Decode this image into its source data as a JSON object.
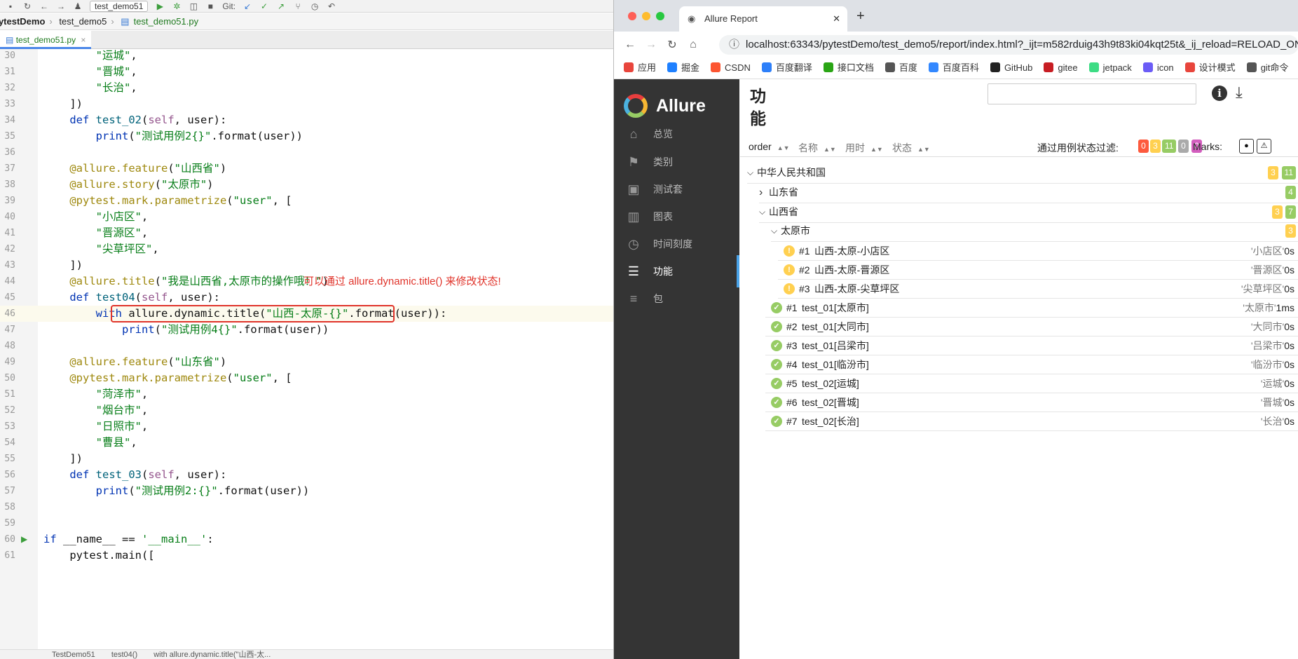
{
  "ide": {
    "run_config": "test_demo51",
    "git_label": "Git:",
    "breadcrumbs": [
      "pytestDemo",
      "test_demo5",
      "test_demo51.py"
    ],
    "file_tab": "test_demo51.py",
    "annotation": "可以通过 allure.dynamic.title() 来修改状态!",
    "status_crumbs": [
      "TestDemo51",
      "test04()",
      "with allure.dynamic.title(\"山西-太..."
    ],
    "lines": [
      {
        "n": "30",
        "code": "        \"运城\","
      },
      {
        "n": "31",
        "code": "        \"晋城\","
      },
      {
        "n": "32",
        "code": "        \"长治\","
      },
      {
        "n": "33",
        "code": "    ])"
      },
      {
        "n": "34",
        "code": "    def test_02(self, user):"
      },
      {
        "n": "35",
        "code": "        print(\"测试用例2{}\".format(user))"
      },
      {
        "n": "36",
        "code": ""
      },
      {
        "n": "37",
        "code": "    @allure.feature(\"山西省\")"
      },
      {
        "n": "38",
        "code": "    @allure.story(\"太原市\")"
      },
      {
        "n": "39",
        "code": "    @pytest.mark.parametrize(\"user\", ["
      },
      {
        "n": "40",
        "code": "        \"小店区\","
      },
      {
        "n": "41",
        "code": "        \"晋源区\","
      },
      {
        "n": "42",
        "code": "        \"尖草坪区\","
      },
      {
        "n": "43",
        "code": "    ])"
      },
      {
        "n": "44",
        "code": "    @allure.title(\"我是山西省,太原市的操作哦！\")"
      },
      {
        "n": "45",
        "code": "    def test04(self, user):"
      },
      {
        "n": "46",
        "code": "        with allure.dynamic.title(\"山西-太原-{}\".format(user)):"
      },
      {
        "n": "47",
        "code": "            print(\"测试用例4{}\".format(user))"
      },
      {
        "n": "48",
        "code": ""
      },
      {
        "n": "49",
        "code": "    @allure.feature(\"山东省\")"
      },
      {
        "n": "50",
        "code": "    @pytest.mark.parametrize(\"user\", ["
      },
      {
        "n": "51",
        "code": "        \"菏泽市\","
      },
      {
        "n": "52",
        "code": "        \"烟台市\","
      },
      {
        "n": "53",
        "code": "        \"日照市\","
      },
      {
        "n": "54",
        "code": "        \"曹县\","
      },
      {
        "n": "55",
        "code": "    ])"
      },
      {
        "n": "56",
        "code": "    def test_03(self, user):"
      },
      {
        "n": "57",
        "code": "        print(\"测试用例2:{}\".format(user))"
      },
      {
        "n": "58",
        "code": ""
      },
      {
        "n": "59",
        "code": ""
      },
      {
        "n": "60",
        "code": "if __name__ == '__main__':"
      },
      {
        "n": "61",
        "code": "    pytest.main(["
      }
    ]
  },
  "browser": {
    "tab_title": "Allure Report",
    "url": "localhost:63343/pytestDemo/test_demo5/report/index.html?_ijt=m582rduig43h9t83ki04kqt25t&_ij_reload=RELOAD_ON_SAVE",
    "bookmarks": [
      {
        "label": "应用",
        "color": "#e8453c"
      },
      {
        "label": "掘金",
        "color": "#1e80ff"
      },
      {
        "label": "CSDN",
        "color": "#fc5531"
      },
      {
        "label": "百度翻译",
        "color": "#2d7ff9"
      },
      {
        "label": "接口文档",
        "color": "#2aa515"
      },
      {
        "label": "百度",
        "color": "#555555"
      },
      {
        "label": "百度百科",
        "color": "#3388ff"
      },
      {
        "label": "GitHub",
        "color": "#222222"
      },
      {
        "label": "gitee",
        "color": "#c71d23"
      },
      {
        "label": "jetpack",
        "color": "#3ddc84"
      },
      {
        "label": "icon",
        "color": "#6b5cf6"
      },
      {
        "label": "设计模式",
        "color": "#e8453c"
      },
      {
        "label": "git命令",
        "color": "#555555"
      }
    ]
  },
  "allure": {
    "brand": "Allure",
    "nav": [
      {
        "label": "总览",
        "icon": "home-icon",
        "glyph": "⌂"
      },
      {
        "label": "类别",
        "icon": "flag-icon",
        "glyph": "⚑"
      },
      {
        "label": "测试套",
        "icon": "briefcase-icon",
        "glyph": "▣"
      },
      {
        "label": "图表",
        "icon": "bar-chart-icon",
        "glyph": "▥"
      },
      {
        "label": "时间刻度",
        "icon": "clock-icon",
        "glyph": "◷"
      },
      {
        "label": "功能",
        "icon": "list-icon",
        "glyph": "☰"
      },
      {
        "label": "包",
        "icon": "package-icon",
        "glyph": "≡"
      }
    ],
    "active_nav": 5,
    "page_title": "功能",
    "sort_columns": [
      "order",
      "名称",
      "用时",
      "状态"
    ],
    "filter_label": "通过用例状态过滤:",
    "filter_counts": [
      {
        "value": "0",
        "color": "#fd5a3e"
      },
      {
        "value": "3",
        "color": "#ffd050"
      },
      {
        "value": "11",
        "color": "#97cc64"
      },
      {
        "value": "0",
        "color": "#aaaaaa"
      },
      {
        "value": "0",
        "color": "#d35ebe"
      }
    ],
    "marks_label": "Marks:",
    "tree": {
      "root": {
        "label": "中华人民共和国",
        "counts": [
          {
            "value": "3",
            "color": "#ffd050"
          },
          {
            "value": "11",
            "color": "#97cc64"
          }
        ]
      },
      "shandong": {
        "label": "山东省",
        "counts": [
          {
            "value": "4",
            "color": "#97cc64"
          }
        ]
      },
      "shanxi": {
        "label": "山西省",
        "counts": [
          {
            "value": "3",
            "color": "#ffd050"
          },
          {
            "value": "7",
            "color": "#97cc64"
          }
        ]
      },
      "taiyuan": {
        "label": "太原市",
        "counts": [
          {
            "value": "3",
            "color": "#ffd050"
          }
        ]
      },
      "taiyuan_cases": [
        {
          "num": "#1",
          "name": "山西-太原-小店区",
          "param": "'小店区'",
          "time": "0s"
        },
        {
          "num": "#2",
          "name": "山西-太原-晋源区",
          "param": "'晋源区'",
          "time": "0s"
        },
        {
          "num": "#3",
          "name": "山西-太原-尖草坪区",
          "param": "'尖草坪区'",
          "time": "0s"
        }
      ],
      "cases": [
        {
          "num": "#1",
          "name": "test_01[太原市]",
          "param": "'太原市'",
          "time": "1ms"
        },
        {
          "num": "#2",
          "name": "test_01[大同市]",
          "param": "'大同市'",
          "time": "0s"
        },
        {
          "num": "#3",
          "name": "test_01[吕梁市]",
          "param": "'吕梁市'",
          "time": "0s"
        },
        {
          "num": "#4",
          "name": "test_01[临汾市]",
          "param": "'临汾市'",
          "time": "0s"
        },
        {
          "num": "#5",
          "name": "test_02[运城]",
          "param": "'运城'",
          "time": "0s"
        },
        {
          "num": "#6",
          "name": "test_02[晋城]",
          "param": "'晋城'",
          "time": "0s"
        },
        {
          "num": "#7",
          "name": "test_02[长治]",
          "param": "'长治'",
          "time": "0s"
        }
      ]
    }
  }
}
